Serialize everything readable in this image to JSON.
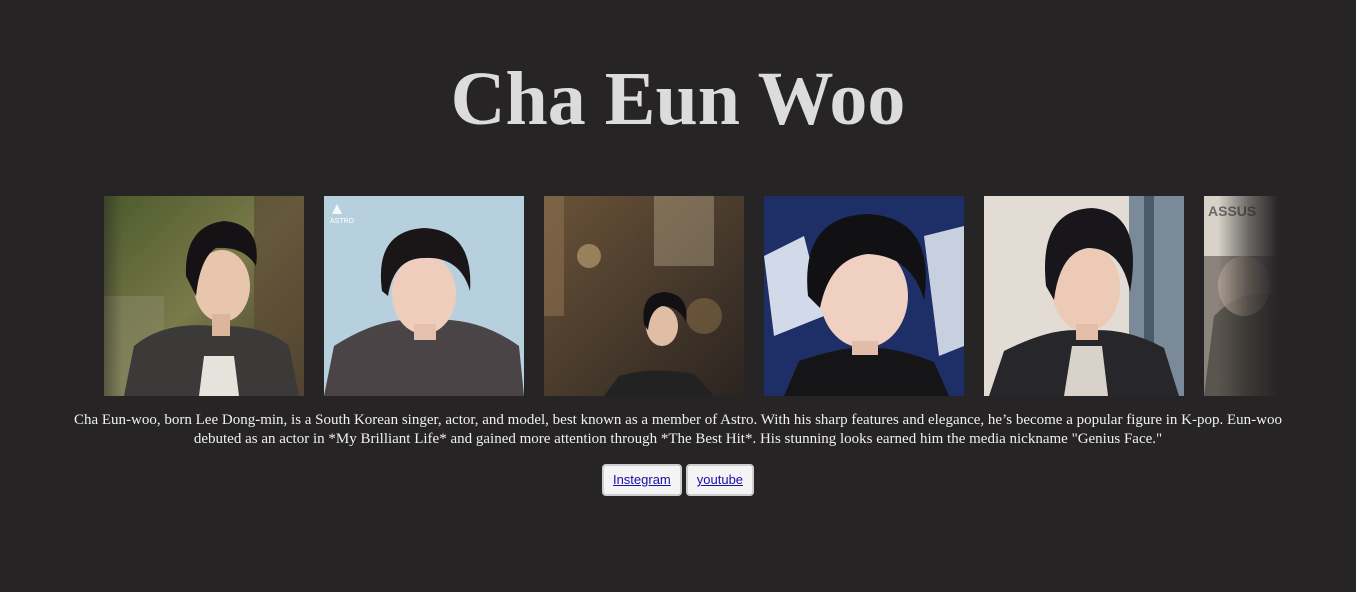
{
  "header": {
    "title": "Cha Eun Woo"
  },
  "gallery": {
    "photos": [
      {
        "alt": "Cha Eun-woo in a leather jacket outdoors",
        "icon": "photo-portrait"
      },
      {
        "alt": "Cha Eun-woo in a grey sweater, ASTRO logo",
        "icon": "photo-portrait",
        "watermark": "ASTRO"
      },
      {
        "alt": "Cha Eun-woo on a city street at night",
        "icon": "photo-portrait"
      },
      {
        "alt": "Cha Eun-woo close-up portrait",
        "icon": "photo-portrait"
      },
      {
        "alt": "Cha Eun-woo in a black hoodie",
        "icon": "photo-portrait"
      },
      {
        "alt": "Partially visible photo",
        "icon": "photo-portrait",
        "watermark": "ASSUS"
      }
    ]
  },
  "bio": {
    "text": "Cha Eun-woo, born Lee Dong-min, is a South Korean singer, actor, and model, best known as a member of Astro. With his sharp features and elegance, he’s become a popular figure in K-pop. Eun-woo debuted as an actor in *My Brilliant Life* and gained more attention through *The Best Hit*. His stunning looks earned him the media nickname \"Genius Face.\""
  },
  "links": {
    "instagram_label": "Instegram",
    "youtube_label": "youtube"
  },
  "colors": {
    "background": "#262425",
    "title": "#dcdcdc",
    "link": "#1a0dab"
  }
}
